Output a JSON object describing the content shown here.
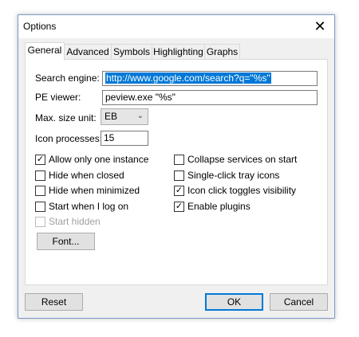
{
  "window": {
    "title": "Options",
    "close_icon": "close-icon"
  },
  "tabs": [
    {
      "label": "General",
      "active": true
    },
    {
      "label": "Advanced",
      "active": false
    },
    {
      "label": "Symbols",
      "active": false
    },
    {
      "label": "Highlighting",
      "active": false
    },
    {
      "label": "Graphs",
      "active": false
    }
  ],
  "general": {
    "search_engine": {
      "label": "Search engine:",
      "value": "http://www.google.com/search?q=\"%s\""
    },
    "pe_viewer": {
      "label": "PE viewer:",
      "value": "peview.exe \"%s\""
    },
    "max_size_unit": {
      "label": "Max. size unit:",
      "value": "EB"
    },
    "icon_processes": {
      "label": "Icon processes:",
      "value": "15"
    },
    "checkboxes_left": [
      {
        "label": "Allow only one instance",
        "checked": true,
        "enabled": true
      },
      {
        "label": "Hide when closed",
        "checked": false,
        "enabled": true
      },
      {
        "label": "Hide when minimized",
        "checked": false,
        "enabled": true
      },
      {
        "label": "Start when I log on",
        "checked": false,
        "enabled": true
      },
      {
        "label": "Start hidden",
        "checked": false,
        "enabled": false
      }
    ],
    "checkboxes_right": [
      {
        "label": "Collapse services on start",
        "checked": false,
        "enabled": true
      },
      {
        "label": "Single-click tray icons",
        "checked": false,
        "enabled": true
      },
      {
        "label": "Icon click toggles visibility",
        "checked": true,
        "enabled": true
      },
      {
        "label": "Enable plugins",
        "checked": true,
        "enabled": true
      }
    ],
    "font_button": "Font..."
  },
  "footer": {
    "reset": "Reset",
    "ok": "OK",
    "cancel": "Cancel"
  },
  "colors": {
    "accent": "#0078d7"
  }
}
